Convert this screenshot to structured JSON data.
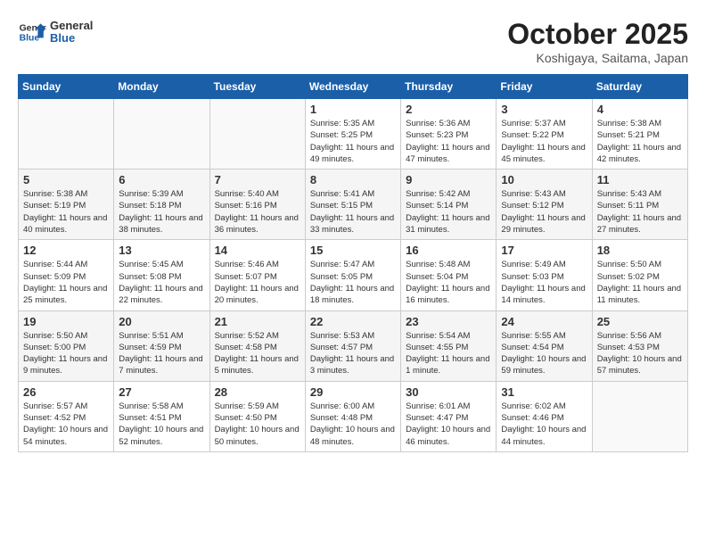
{
  "header": {
    "logo_line1": "General",
    "logo_line2": "Blue",
    "month": "October 2025",
    "location": "Koshigaya, Saitama, Japan"
  },
  "weekdays": [
    "Sunday",
    "Monday",
    "Tuesday",
    "Wednesday",
    "Thursday",
    "Friday",
    "Saturday"
  ],
  "weeks": [
    [
      {
        "day": "",
        "info": ""
      },
      {
        "day": "",
        "info": ""
      },
      {
        "day": "",
        "info": ""
      },
      {
        "day": "1",
        "info": "Sunrise: 5:35 AM\nSunset: 5:25 PM\nDaylight: 11 hours and 49 minutes."
      },
      {
        "day": "2",
        "info": "Sunrise: 5:36 AM\nSunset: 5:23 PM\nDaylight: 11 hours and 47 minutes."
      },
      {
        "day": "3",
        "info": "Sunrise: 5:37 AM\nSunset: 5:22 PM\nDaylight: 11 hours and 45 minutes."
      },
      {
        "day": "4",
        "info": "Sunrise: 5:38 AM\nSunset: 5:21 PM\nDaylight: 11 hours and 42 minutes."
      }
    ],
    [
      {
        "day": "5",
        "info": "Sunrise: 5:38 AM\nSunset: 5:19 PM\nDaylight: 11 hours and 40 minutes."
      },
      {
        "day": "6",
        "info": "Sunrise: 5:39 AM\nSunset: 5:18 PM\nDaylight: 11 hours and 38 minutes."
      },
      {
        "day": "7",
        "info": "Sunrise: 5:40 AM\nSunset: 5:16 PM\nDaylight: 11 hours and 36 minutes."
      },
      {
        "day": "8",
        "info": "Sunrise: 5:41 AM\nSunset: 5:15 PM\nDaylight: 11 hours and 33 minutes."
      },
      {
        "day": "9",
        "info": "Sunrise: 5:42 AM\nSunset: 5:14 PM\nDaylight: 11 hours and 31 minutes."
      },
      {
        "day": "10",
        "info": "Sunrise: 5:43 AM\nSunset: 5:12 PM\nDaylight: 11 hours and 29 minutes."
      },
      {
        "day": "11",
        "info": "Sunrise: 5:43 AM\nSunset: 5:11 PM\nDaylight: 11 hours and 27 minutes."
      }
    ],
    [
      {
        "day": "12",
        "info": "Sunrise: 5:44 AM\nSunset: 5:09 PM\nDaylight: 11 hours and 25 minutes."
      },
      {
        "day": "13",
        "info": "Sunrise: 5:45 AM\nSunset: 5:08 PM\nDaylight: 11 hours and 22 minutes."
      },
      {
        "day": "14",
        "info": "Sunrise: 5:46 AM\nSunset: 5:07 PM\nDaylight: 11 hours and 20 minutes."
      },
      {
        "day": "15",
        "info": "Sunrise: 5:47 AM\nSunset: 5:05 PM\nDaylight: 11 hours and 18 minutes."
      },
      {
        "day": "16",
        "info": "Sunrise: 5:48 AM\nSunset: 5:04 PM\nDaylight: 11 hours and 16 minutes."
      },
      {
        "day": "17",
        "info": "Sunrise: 5:49 AM\nSunset: 5:03 PM\nDaylight: 11 hours and 14 minutes."
      },
      {
        "day": "18",
        "info": "Sunrise: 5:50 AM\nSunset: 5:02 PM\nDaylight: 11 hours and 11 minutes."
      }
    ],
    [
      {
        "day": "19",
        "info": "Sunrise: 5:50 AM\nSunset: 5:00 PM\nDaylight: 11 hours and 9 minutes."
      },
      {
        "day": "20",
        "info": "Sunrise: 5:51 AM\nSunset: 4:59 PM\nDaylight: 11 hours and 7 minutes."
      },
      {
        "day": "21",
        "info": "Sunrise: 5:52 AM\nSunset: 4:58 PM\nDaylight: 11 hours and 5 minutes."
      },
      {
        "day": "22",
        "info": "Sunrise: 5:53 AM\nSunset: 4:57 PM\nDaylight: 11 hours and 3 minutes."
      },
      {
        "day": "23",
        "info": "Sunrise: 5:54 AM\nSunset: 4:55 PM\nDaylight: 11 hours and 1 minute."
      },
      {
        "day": "24",
        "info": "Sunrise: 5:55 AM\nSunset: 4:54 PM\nDaylight: 10 hours and 59 minutes."
      },
      {
        "day": "25",
        "info": "Sunrise: 5:56 AM\nSunset: 4:53 PM\nDaylight: 10 hours and 57 minutes."
      }
    ],
    [
      {
        "day": "26",
        "info": "Sunrise: 5:57 AM\nSunset: 4:52 PM\nDaylight: 10 hours and 54 minutes."
      },
      {
        "day": "27",
        "info": "Sunrise: 5:58 AM\nSunset: 4:51 PM\nDaylight: 10 hours and 52 minutes."
      },
      {
        "day": "28",
        "info": "Sunrise: 5:59 AM\nSunset: 4:50 PM\nDaylight: 10 hours and 50 minutes."
      },
      {
        "day": "29",
        "info": "Sunrise: 6:00 AM\nSunset: 4:48 PM\nDaylight: 10 hours and 48 minutes."
      },
      {
        "day": "30",
        "info": "Sunrise: 6:01 AM\nSunset: 4:47 PM\nDaylight: 10 hours and 46 minutes."
      },
      {
        "day": "31",
        "info": "Sunrise: 6:02 AM\nSunset: 4:46 PM\nDaylight: 10 hours and 44 minutes."
      },
      {
        "day": "",
        "info": ""
      }
    ]
  ]
}
